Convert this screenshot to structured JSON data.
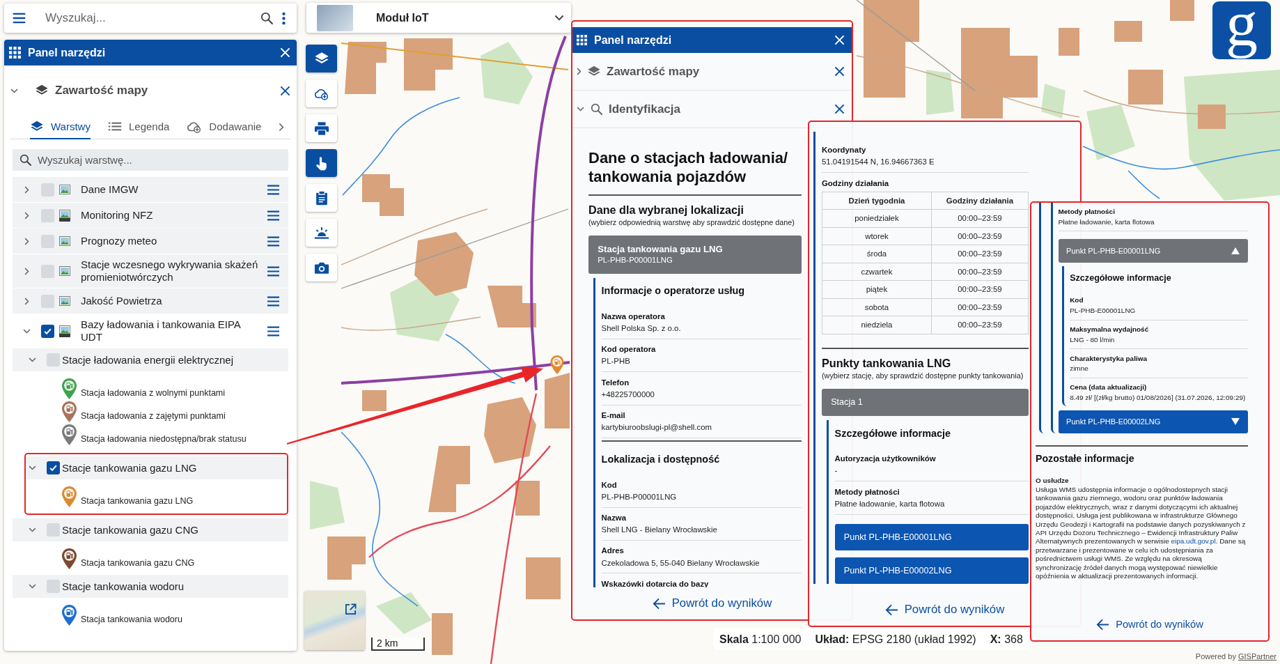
{
  "search": {
    "placeholder": "Wyszukaj..."
  },
  "tool_panel": {
    "title": "Panel narzędzi",
    "section": {
      "title": "Zawartość mapy",
      "expanded": true
    },
    "tabs": [
      {
        "label": "Warstwy",
        "kind": "layers",
        "selected": true
      },
      {
        "label": "Legenda",
        "kind": "legend",
        "selected": false
      },
      {
        "label": "Dodawanie",
        "kind": "add",
        "selected": false
      }
    ],
    "layer_search": {
      "placeholder": "Wyszukaj warstwę..."
    },
    "layers": [
      {
        "name": "Dane IMGW",
        "kind": "image",
        "checked": false,
        "expanded": false
      },
      {
        "name": "Monitoring NFZ",
        "kind": "wms",
        "checked": false,
        "expanded": false
      },
      {
        "name": "Prognozy meteo",
        "kind": "image",
        "checked": false,
        "expanded": false
      },
      {
        "name": "Stacje wczesnego wykrywania skażeń promieniotwórczych",
        "kind": "image",
        "checked": false,
        "expanded": false
      },
      {
        "name": "Jakość Powietrza",
        "kind": "image",
        "checked": false,
        "expanded": false
      },
      {
        "name": "Bazy ładowania i tankowania EIPA UDT",
        "kind": "wms",
        "checked": true,
        "expanded": true,
        "children": [
          {
            "name": "Stacje ładowania energii elektrycznej",
            "checked": false,
            "expanded": true,
            "highlighted": false,
            "legend": [
              {
                "label": "Stacja ładowania z wolnymi punktami",
                "color": "#3fa34d"
              },
              {
                "label": "Stacja ładowania z zajętymi punktami",
                "color": "#a7735d"
              },
              {
                "label": "Stacja ładowania niedostępna/brak statusu",
                "color": "#7a7a7a"
              }
            ]
          },
          {
            "name": "Stacje tankowania gazu LNG",
            "checked": true,
            "expanded": true,
            "highlighted": true,
            "legend": [
              {
                "label": "Stacja tankowania gazu LNG",
                "color": "#d98b33"
              }
            ]
          },
          {
            "name": "Stacje tankowania gazu CNG",
            "checked": false,
            "expanded": true,
            "highlighted": false,
            "legend": [
              {
                "label": "Stacja tankowania gazu CNG",
                "color": "#7b4a30"
              }
            ]
          },
          {
            "name": "Stacje tankowania wodoru",
            "checked": false,
            "expanded": true,
            "highlighted": false,
            "legend": [
              {
                "label": "Stacja tankowania wodoru",
                "color": "#1e6fd0"
              }
            ]
          }
        ]
      }
    ]
  },
  "module_select": {
    "value": "Moduł IoT"
  },
  "tools": [
    {
      "kind": "layers",
      "active": true
    },
    {
      "kind": "cloud_add",
      "active": false
    },
    {
      "kind": "print",
      "active": false
    },
    {
      "kind": "touch",
      "active": true
    },
    {
      "kind": "clipboard",
      "active": false
    },
    {
      "kind": "sunrise",
      "active": false
    },
    {
      "kind": "camera",
      "active": false
    }
  ],
  "scale_bar": {
    "label": "2 km"
  },
  "logo": {
    "letter": "g"
  },
  "detail_panels": [
    {
      "highlighted": true,
      "header": {
        "title": "Panel narzędzi"
      },
      "sections": [
        {
          "title": "Zawartość mapy",
          "kind": "layers",
          "expanded": false
        },
        {
          "title": "Identyfikacja",
          "kind": "identify",
          "expanded": true
        }
      ],
      "blocks": [
        {
          "kind": "title",
          "text": "Dane o stacjach ładowania/ tankowania pojazdów"
        },
        {
          "kind": "heading",
          "text": "Dane dla wybranej lokalizacji",
          "note": "(wybierz odpowiednią warstwę aby sprawdzić dostępne dane)"
        },
        {
          "kind": "accordion",
          "label": "Stacja tankowania gazu LNG",
          "sublabel": "PL-PHB-P00001LNG",
          "expanded": true
        },
        {
          "kind": "section",
          "children": [
            {
              "kind": "subheading",
              "text": "Informacje o operatorze usług"
            },
            {
              "kind": "field",
              "label": "Nazwa operatora",
              "value": "Shell Polska Sp. z o.o."
            },
            {
              "kind": "field",
              "label": "Kod operatora",
              "value": "PL-PHB"
            },
            {
              "kind": "field",
              "label": "Telefon",
              "value": "+48225700000"
            },
            {
              "kind": "field",
              "label": "E-mail",
              "value": "kartybiuroobslugi-pl@shell.com"
            },
            {
              "kind": "subheading",
              "text": "Lokalizacja i dostępność"
            },
            {
              "kind": "field",
              "label": "Kod",
              "value": "PL-PHB-P00001LNG"
            },
            {
              "kind": "field",
              "label": "Nazwa",
              "value": "Shell LNG - Bielany Wrocławskie"
            },
            {
              "kind": "field",
              "label": "Adres",
              "value": "Czekoladowa 5, 55-040 Bielany Wrocławskie"
            },
            {
              "kind": "field",
              "label": "Wskazówki dotarcia do bazy"
            }
          ]
        }
      ],
      "back_link": "Powrót do wyników"
    },
    {
      "highlighted": true,
      "blocks": [
        {
          "kind": "section",
          "children": [
            {
              "kind": "field",
              "label": "Koordynaty",
              "value": "51.04191544 N, 16.94667363 E"
            },
            {
              "kind": "table",
              "label": "Godziny działania",
              "columns": [
                "Dzień tygodnia",
                "Godziny działania"
              ],
              "rows": [
                [
                  "poniedziałek",
                  "00:00–23:59"
                ],
                [
                  "wtorek",
                  "00:00–23:59"
                ],
                [
                  "środa",
                  "00:00–23:59"
                ],
                [
                  "czwartek",
                  "00:00–23:59"
                ],
                [
                  "piątek",
                  "00:00–23:59"
                ],
                [
                  "sobota",
                  "00:00–23:59"
                ],
                [
                  "niedziela",
                  "00:00–23:59"
                ]
              ]
            },
            {
              "kind": "heading",
              "text": "Punkty tankowania LNG",
              "note": "(wybierz stację, aby sprawdzić dostępne punkty tankowania)"
            },
            {
              "kind": "accordion",
              "label": "Stacja 1",
              "expanded": true
            },
            {
              "kind": "section",
              "children": [
                {
                  "kind": "subheading",
                  "text": "Szczegółowe informacje"
                },
                {
                  "kind": "field",
                  "label": "Autoryzacja użytkowników",
                  "value": "-"
                },
                {
                  "kind": "field",
                  "label": "Metody płatności",
                  "value": "Płatne ładowanie, karta flotowa"
                },
                {
                  "kind": "accordion",
                  "label": "Punkt PL-PHB-E00001LNG",
                  "expanded": false
                },
                {
                  "kind": "accordion",
                  "label": "Punkt PL-PHB-E00002LNG",
                  "expanded": false
                }
              ]
            }
          ]
        }
      ],
      "back_link": "Powrót do wyników"
    },
    {
      "highlighted": true,
      "blocks": [
        {
          "kind": "section",
          "children": [
            {
              "kind": "section",
              "children": [
                {
                  "kind": "field",
                  "label": "Metody płatności",
                  "value": "Płatne ładowanie, karta flotowa"
                },
                {
                  "kind": "accordion",
                  "label": "Punkt PL-PHB-E00001LNG",
                  "expanded": true,
                  "caret": true
                },
                {
                  "kind": "section",
                  "children": [
                    {
                      "kind": "subheading",
                      "text": "Szczegółowe informacje"
                    },
                    {
                      "kind": "field",
                      "label": "Kod",
                      "value": "PL-PHB-E00001LNG"
                    },
                    {
                      "kind": "field",
                      "label": "Maksymalna wydajność",
                      "value": "LNG - 80 l/min"
                    },
                    {
                      "kind": "field",
                      "label": "Charakterystyka paliwa",
                      "value": "zimne"
                    },
                    {
                      "kind": "field",
                      "label": "Cena (data aktualizacji)",
                      "value": "8.49 zł/ [(zł/kg brutto) 01/08/2026] (31.07.2026, 12:09:29)"
                    }
                  ]
                },
                {
                  "kind": "accordion",
                  "label": "Punkt PL-PHB-E00002LNG",
                  "expanded": false,
                  "caret": true
                }
              ]
            }
          ]
        },
        {
          "kind": "heading",
          "text": "Pozostałe informacje"
        },
        {
          "kind": "paragraph",
          "label": "O usłudze",
          "text_before": "Usługa WMS udostępnia informacje o ogólnodostepnych stacji tankowania gazu ziemnego, wodoru oraz punktów ładowania pojazdów elektrycznych, wraz z danymi dotyczącymi ich aktualnej dostępności. Usługa jest publikowana w infrastrukturze Głównego Urzędu Geodezji i Kartografii na podstawie danych pozyskiwanych z API Urzędu Dozoru Technicznego – Ewidencji Infrastruktury Paliw Alternatywnych prezentowanych w serwisie ",
          "link": "eipa.udt.gov.pl",
          "text_after": ". Dane są przetwarzane i prezentowane w celu ich udostępniania za pośrednictwem usługi WMS. Ze względu na okresową synchronizację źródeł danych mogą występować niewielkie opóźnienia w aktualizacji prezentowanych informacji."
        }
      ],
      "back_link": "Powrót do wyników"
    }
  ],
  "status_bar": {
    "items": [
      "**Skala** 1:100 000",
      "**Układ:** EPSG 2180 (układ 1992)",
      "**X:** 368"
    ]
  },
  "attribution": {
    "text": "Powered by ",
    "link": "GISPartner"
  }
}
